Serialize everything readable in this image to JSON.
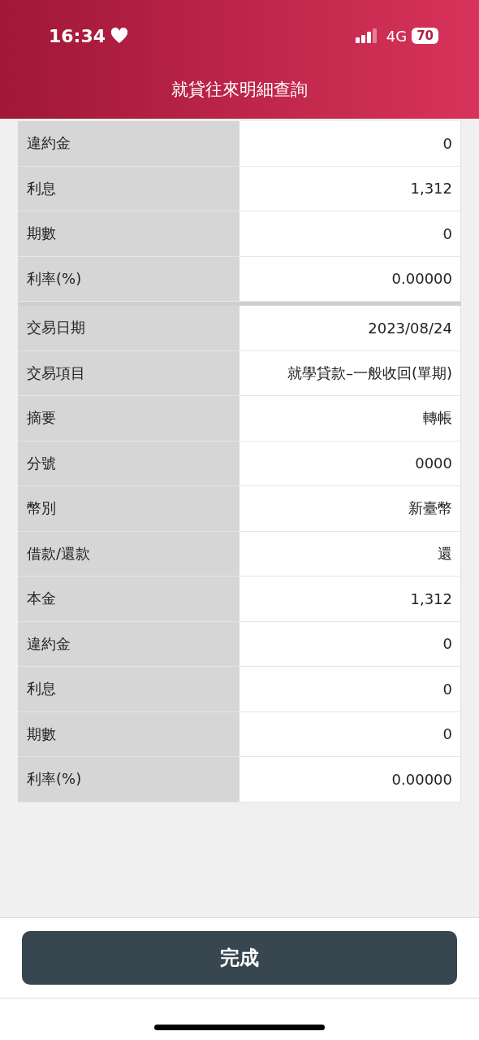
{
  "status_bar": {
    "time": "16:34",
    "network": "4G",
    "battery": "70"
  },
  "title": "就貸往來明細查詢",
  "sections": [
    {
      "rows": [
        {
          "label": "違約金",
          "value": "0"
        },
        {
          "label": "利息",
          "value": "1,312"
        },
        {
          "label": "期數",
          "value": "0"
        },
        {
          "label": "利率(%)",
          "value": "0.00000"
        }
      ]
    },
    {
      "rows": [
        {
          "label": "交易日期",
          "value": "2023/08/24"
        },
        {
          "label": "交易項目",
          "value": "就學貸款–一般收回(單期)"
        },
        {
          "label": "摘要",
          "value": "轉帳"
        },
        {
          "label": "分號",
          "value": "0000"
        },
        {
          "label": "幣別",
          "value": "新臺幣"
        },
        {
          "label": "借款/還款",
          "value": "還"
        },
        {
          "label": "本金",
          "value": "1,312"
        },
        {
          "label": "違約金",
          "value": "0"
        },
        {
          "label": "利息",
          "value": "0"
        },
        {
          "label": "期數",
          "value": "0"
        },
        {
          "label": "利率(%)",
          "value": "0.00000"
        }
      ]
    }
  ],
  "button": "完成"
}
